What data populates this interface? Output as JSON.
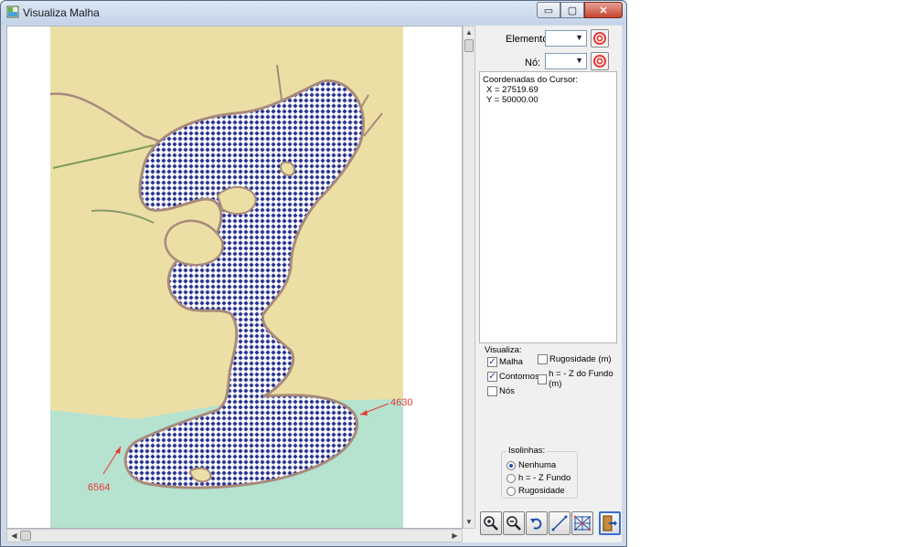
{
  "window": {
    "title": "Visualiza Malha",
    "buttons": {
      "minimize": "▭",
      "maximize": "▢",
      "close": "✕"
    }
  },
  "panel": {
    "elemento_label": "Elemento:",
    "no_label": "Nó:",
    "elemento_value": "",
    "no_value": "",
    "cursor_title": "Coordenadas do Cursor:",
    "cursor_x": "X = 27519.69",
    "cursor_y": "Y = 50000.00",
    "visualiza": {
      "title": "Visualiza:",
      "options": [
        {
          "label": "Malha",
          "checked": true
        },
        {
          "label": "Contornos",
          "checked": true
        },
        {
          "label": "Nós",
          "checked": false
        },
        {
          "label": "Rugosidade (m)",
          "checked": false
        },
        {
          "label": "h = - Z do Fundo (m)",
          "checked": false
        }
      ]
    },
    "isolinhas": {
      "title": "Isolinhas:",
      "options": [
        {
          "label": "Nenhuma",
          "selected": true
        },
        {
          "label": "h = - Z Fundo",
          "selected": false
        },
        {
          "label": "Rugosidade",
          "selected": false
        }
      ]
    }
  },
  "map": {
    "node_labels": [
      {
        "text": "4630"
      },
      {
        "text": "6564"
      }
    ],
    "colors": {
      "land": "#ecdfa6",
      "sea": "#b6e2d0",
      "mesh": "#1a237e",
      "contour": "#a88a7a",
      "annotation": "#e53935"
    }
  },
  "toolbar": {
    "icons": [
      "zoom-in-icon",
      "zoom-out-icon",
      "undo-zoom-icon",
      "draw-line-icon",
      "mesh-grid-icon",
      "exit-icon"
    ]
  }
}
